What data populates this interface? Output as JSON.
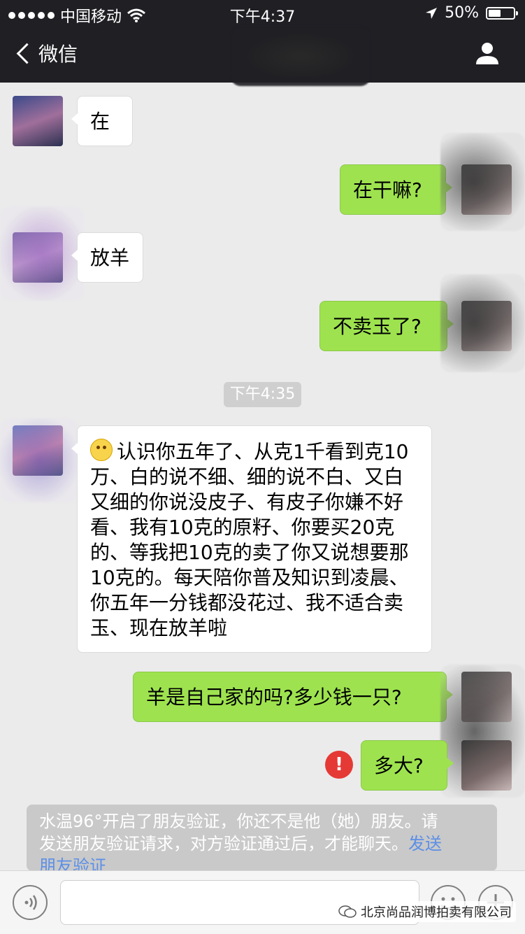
{
  "status_bar": {
    "carrier": "中国移动",
    "time": "下午4:37",
    "battery_text": "50%",
    "battery_level": 0.5
  },
  "nav": {
    "back_label": "微信"
  },
  "messages": [
    {
      "side": "in",
      "text": "在"
    },
    {
      "side": "out",
      "text": "在干嘛?"
    },
    {
      "side": "in",
      "text": "放羊"
    },
    {
      "side": "out",
      "text": "不卖玉了?"
    },
    {
      "side": "time",
      "text": "下午4:35"
    },
    {
      "side": "in",
      "text": "认识你五年了、从克1千看到克10万、白的说不细、细的说不白、又白又细的你说没皮子、有皮子你嫌不好看、我有10克的原籽、你要买20克的、等我把10克的卖了你又说想要那10克的。每天陪你普及知识到凌晨、你五年一分钱都没花过、我不适合卖玉、现在放羊啦"
    },
    {
      "side": "out",
      "text": "羊是自己家的吗?多少钱一只?"
    },
    {
      "side": "out",
      "text": "多大?",
      "failed": true
    }
  ],
  "long_message_lines": [
    "认识你五年了、从克1千看到克10",
    "万、白的说不细、细的说不白、又白",
    "又细的你说没皮子、有皮子你嫌不好",
    "看、我有10克的原籽、你要买20克",
    "的、等我把10克的卖了你又说想要那",
    "10克的。每天陪你普及知识到凌晨、",
    "你五年一分钱都没花过、我不适合卖",
    "玉、现在放羊啦"
  ],
  "system_notice": {
    "line1": "水温96°开启了朋友验证，你还不是他（她）朋友。请",
    "line2": "发送朋友验证请求，对方验证通过后，才能聊天。",
    "link1": "发送",
    "link2": "朋友验证"
  },
  "error_badge": "!",
  "watermark": "北京尚品润博拍卖有限公司"
}
